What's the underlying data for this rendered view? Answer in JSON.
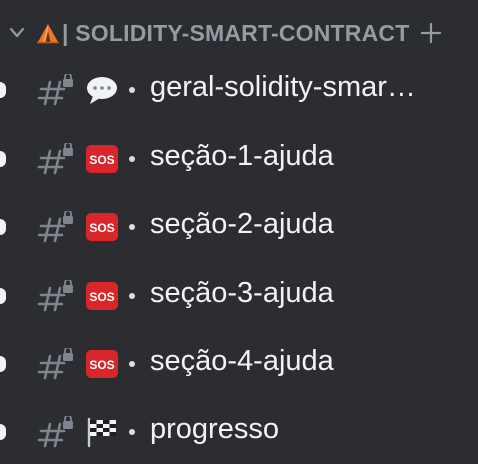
{
  "category": {
    "emoji_icon": "tent-icon",
    "label": "| SOLIDITY-SMART-CONTRACT",
    "add_icon": "plus-icon"
  },
  "channels": [
    {
      "emoji_icon": "speech-bubble-icon",
      "name": "geral-solidity-smar…",
      "unread": true
    },
    {
      "emoji_icon": "sos-icon",
      "name": "seção-1-ajuda",
      "unread": true
    },
    {
      "emoji_icon": "sos-icon",
      "name": "seção-2-ajuda",
      "unread": true
    },
    {
      "emoji_icon": "sos-icon",
      "name": "seção-3-ajuda",
      "unread": true
    },
    {
      "emoji_icon": "sos-icon",
      "name": "seção-4-ajuda",
      "unread": true
    },
    {
      "emoji_icon": "checkered-flag-icon",
      "name": "progresso",
      "unread": true
    }
  ],
  "colors": {
    "background": "#2b2d31",
    "category_text": "#949ba4",
    "channel_text": "#f2f3f5",
    "sos_red": "#d9262a"
  }
}
